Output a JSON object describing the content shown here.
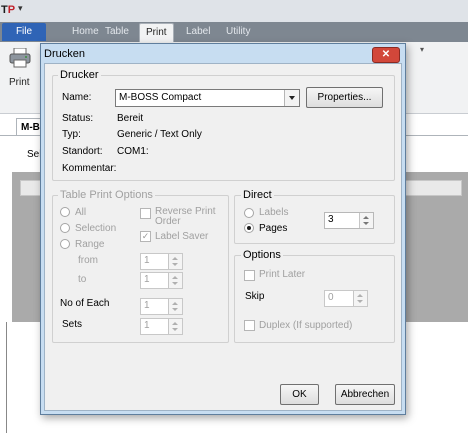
{
  "app": {
    "logo_t": "T",
    "logo_p": "P",
    "qat_arrow": "▾"
  },
  "ribbon": {
    "tabs": [
      "File",
      "Home",
      "Table",
      "Print",
      "Label",
      "Utility"
    ],
    "print_button_label": "Print",
    "combo_arrow": "▾"
  },
  "document": {
    "tab_label": "M-B",
    "selection_label": "Sel"
  },
  "dialog": {
    "title": "Drucken",
    "close_glyph": "✕",
    "printer_group": {
      "legend": "Drucker",
      "name_label": "Name:",
      "name_value": "M-BOSS Compact",
      "properties_button": "Properties...",
      "status_label": "Status:",
      "status_value": "Bereit",
      "type_label": "Typ:",
      "type_value": "Generic / Text Only",
      "location_label": "Standort:",
      "location_value": "COM1:",
      "comment_label": "Kommentar:"
    },
    "table_options": {
      "legend": "Table Print Options",
      "radio_all": "All",
      "radio_selection": "Selection",
      "radio_range": "Range",
      "from_label": "from",
      "from_value": "1",
      "to_label": "to",
      "to_value": "1",
      "reverse_label_1": "Reverse Print",
      "reverse_label_2": "Order",
      "label_saver": "Label Saver",
      "label_saver_checked": true,
      "no_of_each_label": "No of Each",
      "no_of_each_value": "1",
      "sets_label": "Sets",
      "sets_value": "1"
    },
    "direct": {
      "legend": "Direct",
      "radio_labels": "Labels",
      "radio_pages": "Pages",
      "selected": "Pages",
      "count_value": "3"
    },
    "options": {
      "legend": "Options",
      "print_later": "Print Later",
      "skip_label": "Skip",
      "skip_value": "0",
      "duplex": "Duplex (If supported)"
    },
    "ok_button": "OK",
    "cancel_button": "Abbrechen"
  }
}
